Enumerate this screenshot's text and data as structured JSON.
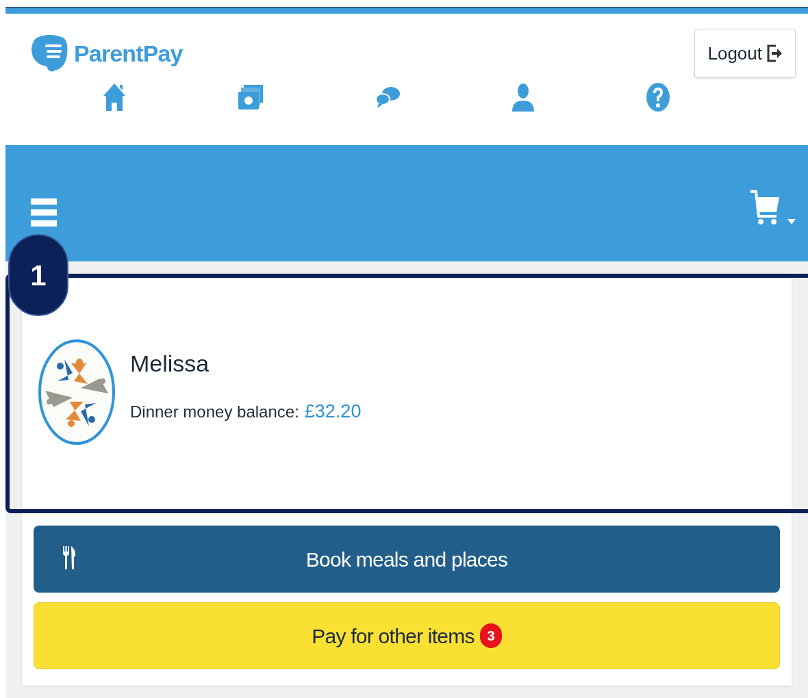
{
  "header": {
    "logo": "ParentPay",
    "logout": "Logout"
  },
  "annotation": {
    "number": "1"
  },
  "child": {
    "name": "Melissa",
    "balance_label": "Dinner money balance:",
    "balance": "£32.20"
  },
  "actions": [
    {
      "kind": "primary",
      "label": "Book meals and places"
    },
    {
      "kind": "warning",
      "label": "Pay for other items",
      "badge": "3"
    }
  ]
}
